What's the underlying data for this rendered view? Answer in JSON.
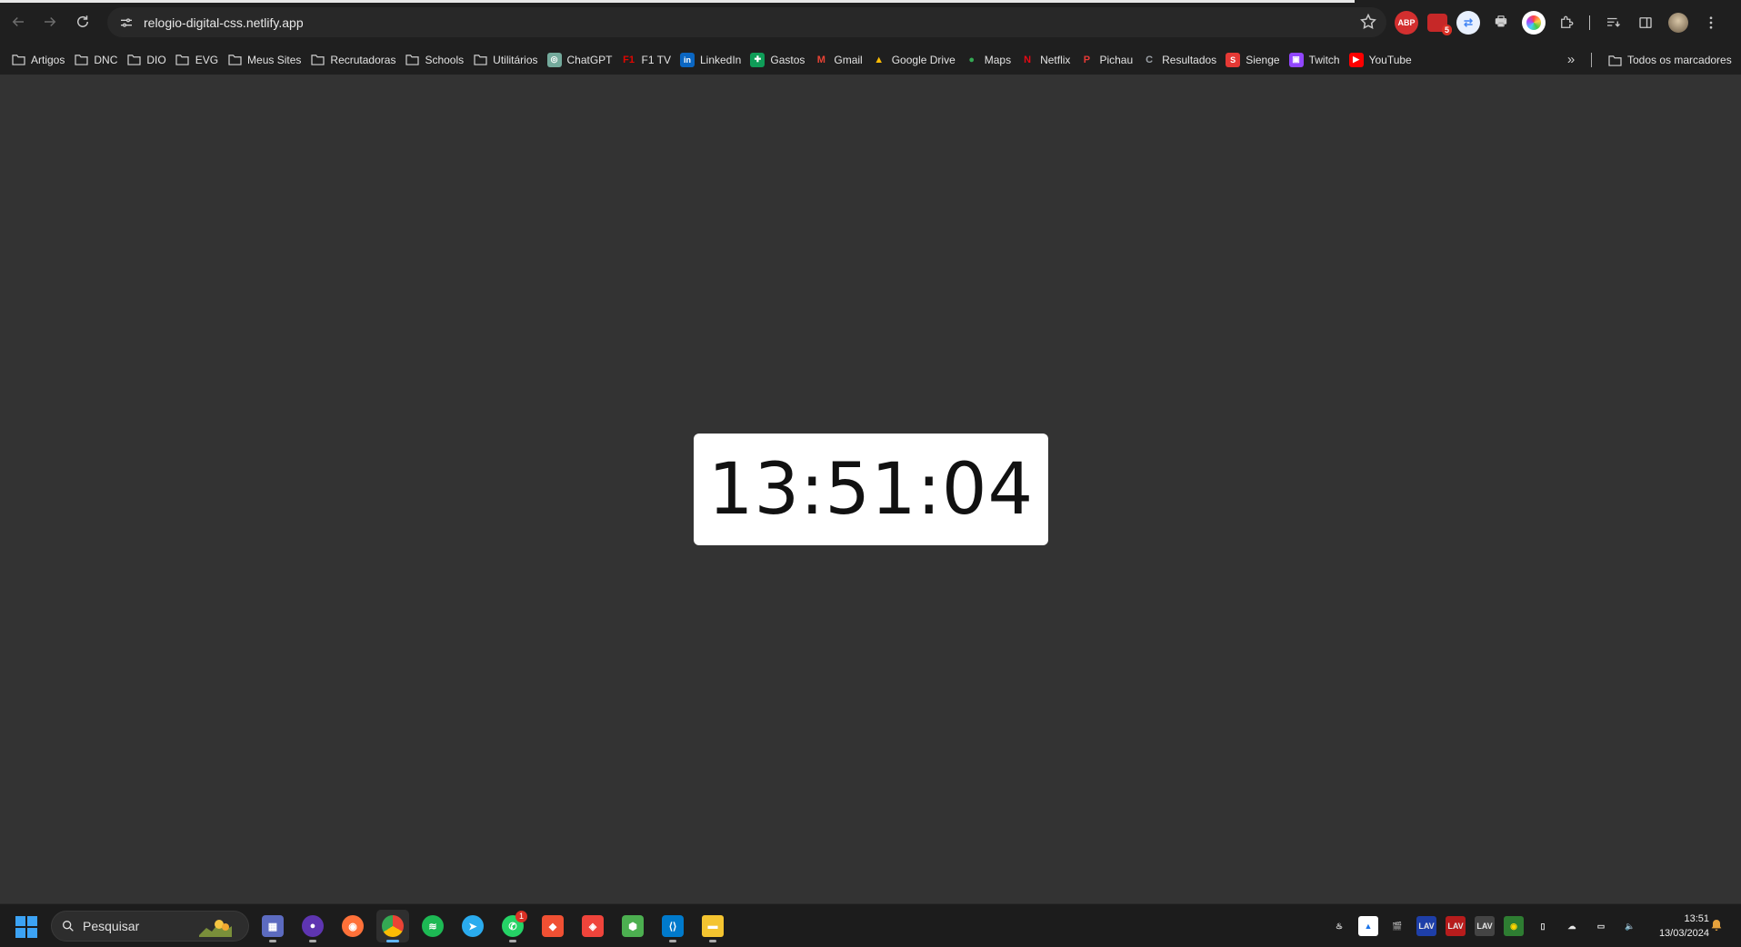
{
  "browser": {
    "url": "relogio-digital-css.netlify.app",
    "extensions": [
      {
        "name": "adblock-plus",
        "label": "ABP",
        "color": "#d32f2f"
      },
      {
        "name": "mail-checker",
        "label": "",
        "badge": "5",
        "color": "#c62828"
      },
      {
        "name": "translate",
        "label": "",
        "color": "#4285f4"
      },
      {
        "name": "print",
        "label": "",
        "color": "#5f5f5f"
      },
      {
        "name": "color-picker",
        "label": "",
        "color": "#a259ff"
      }
    ]
  },
  "bookmarks": [
    {
      "label": "Artigos",
      "icon": "folder-icon"
    },
    {
      "label": "DNC",
      "icon": "folder-icon"
    },
    {
      "label": "DIO",
      "icon": "folder-icon"
    },
    {
      "label": "EVG",
      "icon": "folder-icon"
    },
    {
      "label": "Meus Sites",
      "icon": "folder-icon"
    },
    {
      "label": "Recrutadoras",
      "icon": "folder-icon"
    },
    {
      "label": "Schools",
      "icon": "folder-icon"
    },
    {
      "label": "Utilitários",
      "icon": "folder-icon"
    },
    {
      "label": "ChatGPT",
      "icon": "chatgpt-icon"
    },
    {
      "label": "F1 TV",
      "icon": "f1-icon"
    },
    {
      "label": "LinkedIn",
      "icon": "linkedin-icon"
    },
    {
      "label": "Gastos",
      "icon": "sheets-icon"
    },
    {
      "label": "Gmail",
      "icon": "gmail-icon"
    },
    {
      "label": "Google Drive",
      "icon": "drive-icon"
    },
    {
      "label": "Maps",
      "icon": "maps-icon"
    },
    {
      "label": "Netflix",
      "icon": "netflix-icon"
    },
    {
      "label": "Pichau",
      "icon": "pichau-icon"
    },
    {
      "label": "Resultados",
      "icon": "resultados-icon"
    },
    {
      "label": "Sienge",
      "icon": "sienge-icon"
    },
    {
      "label": "Twitch",
      "icon": "twitch-icon"
    },
    {
      "label": "YouTube",
      "icon": "youtube-icon"
    }
  ],
  "all_bookmarks_label": "Todos os marcadores",
  "clock": {
    "time": "13:51:04"
  },
  "taskbar": {
    "search_placeholder": "Pesquisar",
    "apps": [
      {
        "name": "calculator",
        "badge": ""
      },
      {
        "name": "app-purple",
        "badge": ""
      },
      {
        "name": "firefox",
        "badge": ""
      },
      {
        "name": "chrome",
        "badge": ""
      },
      {
        "name": "spotify",
        "badge": ""
      },
      {
        "name": "telegram",
        "badge": ""
      },
      {
        "name": "whatsapp",
        "badge": "1"
      },
      {
        "name": "git",
        "badge": ""
      },
      {
        "name": "anydesk",
        "badge": ""
      },
      {
        "name": "nodejs",
        "badge": ""
      },
      {
        "name": "vscode",
        "badge": ""
      },
      {
        "name": "file-explorer",
        "badge": ""
      }
    ],
    "time": "13:51",
    "date": "13/03/2024"
  }
}
